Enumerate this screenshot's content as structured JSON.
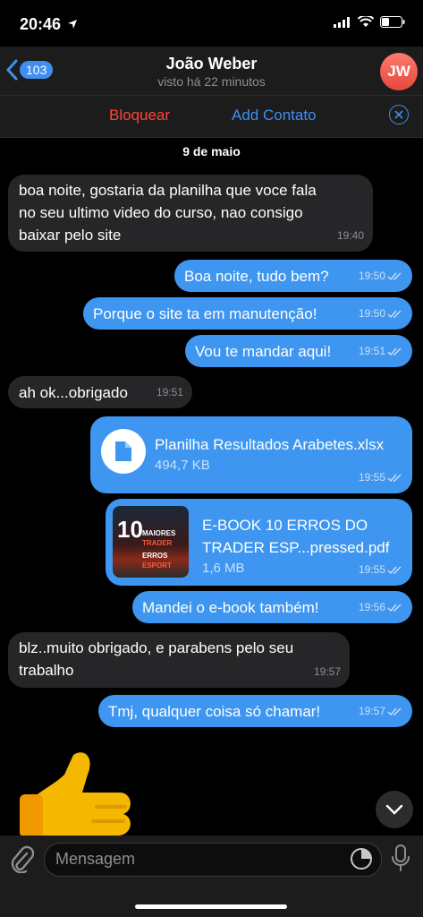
{
  "status": {
    "time": "20:46"
  },
  "header": {
    "unread_count": "103",
    "contact_name": "João Weber",
    "last_seen": "visto há 22 minutos",
    "avatar_initials": "JW"
  },
  "actions": {
    "block": "Bloquear",
    "add": "Add Contato"
  },
  "chat": {
    "date": "9 de maio",
    "messages": [
      {
        "text": "boa noite, gostaria da planilha que voce fala no seu ultimo video do curso, nao consigo baixar pelo site",
        "time": "19:40"
      },
      {
        "text": "Boa noite, tudo bem?",
        "time": "19:50"
      },
      {
        "text": "Porque o site ta em manutenção!",
        "time": "19:50"
      },
      {
        "text": "Vou te mandar aqui!",
        "time": "19:51"
      },
      {
        "text": "ah ok...obrigado",
        "time": "19:51"
      },
      {
        "file_name": "Planilha Resultados Arabetes.xlsx",
        "file_size": "494,7 KB",
        "time": "19:55"
      },
      {
        "file_name_line1": "E-BOOK 10 ERROS DO",
        "file_name_line2": "TRADER ESP...pressed.pdf",
        "file_size": "1,6 MB",
        "time": "19:55",
        "thumb_number": "10",
        "thumb_line1": "MAIORES ERROS",
        "thumb_line2": "TRADER ESPORT"
      },
      {
        "text": "Mandei o e-book também!",
        "time": "19:56"
      },
      {
        "text": "blz..muito obrigado, e parabens pelo seu trabalho",
        "time": "19:57"
      },
      {
        "text": "Tmj, qualquer coisa só chamar!",
        "time": "19:57"
      }
    ]
  },
  "input": {
    "placeholder": "Mensagem"
  },
  "colors": {
    "accent": "#3e8ff0",
    "outgoing": "#3e96f0",
    "incoming": "#262628",
    "danger": "#ff453a"
  }
}
